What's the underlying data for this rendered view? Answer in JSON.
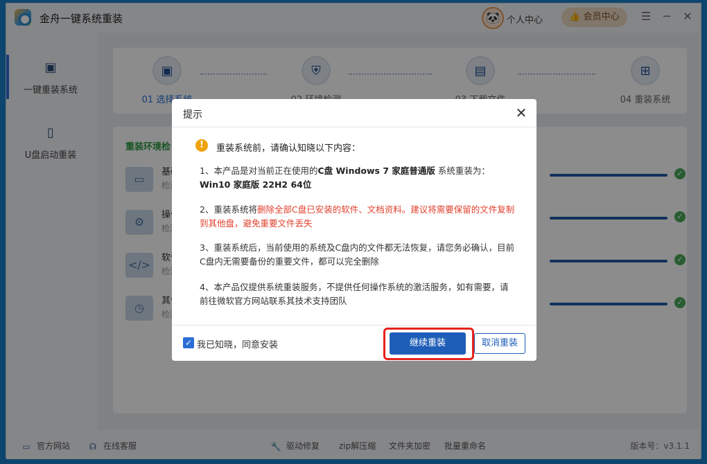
{
  "app": {
    "title": "金舟一键系统重装",
    "personal_center": "个人中心",
    "vip_center": "会员中心",
    "minimize_icon": "─",
    "close_icon": "✕",
    "menu_icon": "☰"
  },
  "sidebar": {
    "items": [
      {
        "label": "一键重装系统",
        "icon": "monitor-icon"
      },
      {
        "label": "U盘启动重装",
        "icon": "usb-icon"
      }
    ]
  },
  "steps": [
    {
      "label": "01 选择系统"
    },
    {
      "label": "02 环境检测"
    },
    {
      "label": "03 下载文件"
    },
    {
      "label": "04 重装系统"
    }
  ],
  "env": {
    "title": "重装环境检",
    "rows": [
      {
        "name": "基础",
        "sub": "检测"
      },
      {
        "name": "操作",
        "sub": "检测"
      },
      {
        "name": "软件",
        "sub": "检测"
      },
      {
        "name": "其他",
        "sub": "检测"
      }
    ]
  },
  "footer": {
    "official_site": "官方网站",
    "online_service": "在线客服",
    "driver_repair": "驱动修复",
    "zip_tool": "zip解压缩",
    "folder_encrypt": "文件夹加密",
    "batch_rename": "批量重命名",
    "version": "版本号：v3.1.1"
  },
  "dialog": {
    "title": "提示",
    "intro": "重装系统前，请确认知晓以下内容：",
    "p1_prefix": "1、本产品是对当前正在使用的",
    "p1_bold": "C盘 Windows 7 家庭普通版",
    "p1_mid": " 系统重装为：",
    "p1_target": "Win10 家庭版 22H2 64位",
    "p2_prefix": "2、重装系统将",
    "p2_red": "删除全部C盘已安装的软件、文档资料。建议将需要保留的文件复制到其他盘，避免重要文件丢失",
    "p3": "3、重装系统后，当前使用的系统及C盘内的文件都无法恢复，请您务必确认，目前C盘内无需要备份的重要文件，都可以完全删除",
    "p4": "4、本产品仅提供系统重装服务，不提供任何操作系统的激活服务，如有需要，请前往微软官方网站联系其技术支持团队",
    "agree_label": "我已知晓，同意安装",
    "continue_label": "继续重装",
    "cancel_label": "取消重装"
  },
  "colors": {
    "primary": "#1f5eb8",
    "warning": "#f0a20a",
    "danger": "#e0412e",
    "success": "#4aa85a"
  }
}
